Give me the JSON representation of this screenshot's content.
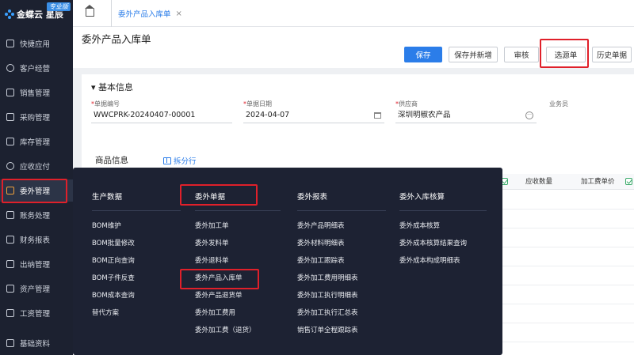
{
  "brand": {
    "name": "金蝶云 星辰",
    "badge": "专业版"
  },
  "sidebar": {
    "items": [
      {
        "label": "快捷应用",
        "icon": "grid-icon"
      },
      {
        "label": "客户经营",
        "icon": "user-icon"
      },
      {
        "label": "销售管理",
        "icon": "tag-icon"
      },
      {
        "label": "采购管理",
        "icon": "cart-icon"
      },
      {
        "label": "库存管理",
        "icon": "warehouse-icon"
      },
      {
        "label": "应收应付",
        "icon": "money-icon"
      },
      {
        "label": "委外管理",
        "icon": "outsource-icon"
      },
      {
        "label": "账务处理",
        "icon": "ledger-icon"
      },
      {
        "label": "财务报表",
        "icon": "report-icon"
      },
      {
        "label": "出纳管理",
        "icon": "cashier-icon"
      },
      {
        "label": "资产管理",
        "icon": "asset-icon"
      },
      {
        "label": "工资管理",
        "icon": "salary-icon"
      },
      {
        "label": "基础资料",
        "icon": "database-icon"
      }
    ]
  },
  "tabs": [
    {
      "label": "委外产品入库单",
      "close": "×"
    }
  ],
  "page": {
    "title": "委外产品入库单",
    "buttons": {
      "save": "保存",
      "save_new": "保存并新增",
      "audit": "审核",
      "select_source": "选源单",
      "history": "历史单据"
    }
  },
  "basic_info": {
    "title": "▾ 基本信息",
    "fields": {
      "bill_no": {
        "label": "单据编号",
        "value": "WWCPRK-20240407-00001"
      },
      "bill_date": {
        "label": "单据日期",
        "value": "2024-04-07"
      },
      "supplier": {
        "label": "供应商",
        "value": "深圳明椒农产品"
      },
      "salesman": {
        "label": "业务员",
        "value": ""
      }
    }
  },
  "goods": {
    "title": "商品信息",
    "split_label": "拆分行",
    "columns": {
      "received_qty": "应收数量",
      "processing_price": "加工费单价"
    }
  },
  "flyout": {
    "columns": [
      {
        "title": "生产数据",
        "items": [
          "BOM维护",
          "BOM批量修改",
          "BOM正向查询",
          "BOM子件反查",
          "BOM成本查询",
          "替代方案"
        ]
      },
      {
        "title": "委外单据",
        "items": [
          "委外加工单",
          "委外发料单",
          "委外退料单",
          "委外产品入库单",
          "委外产品退货单",
          "委外加工费用",
          "委外加工费（退货）"
        ]
      },
      {
        "title": "委外报表",
        "items": [
          "委外产品明细表",
          "委外材料明细表",
          "委外加工跟踪表",
          "委外加工费用明细表",
          "委外加工执行明细表",
          "委外加工执行汇总表",
          "销售订单全程跟踪表"
        ]
      },
      {
        "title": "委外入库核算",
        "items": [
          "委外成本核算",
          "委外成本核算结果查询",
          "委外成本构成明细表"
        ]
      }
    ]
  },
  "colors": {
    "accent": "#2b7de9",
    "highlight": "#e0202a",
    "sidebar_bg": "#1c2130",
    "flyout_bg": "#1d2233"
  }
}
